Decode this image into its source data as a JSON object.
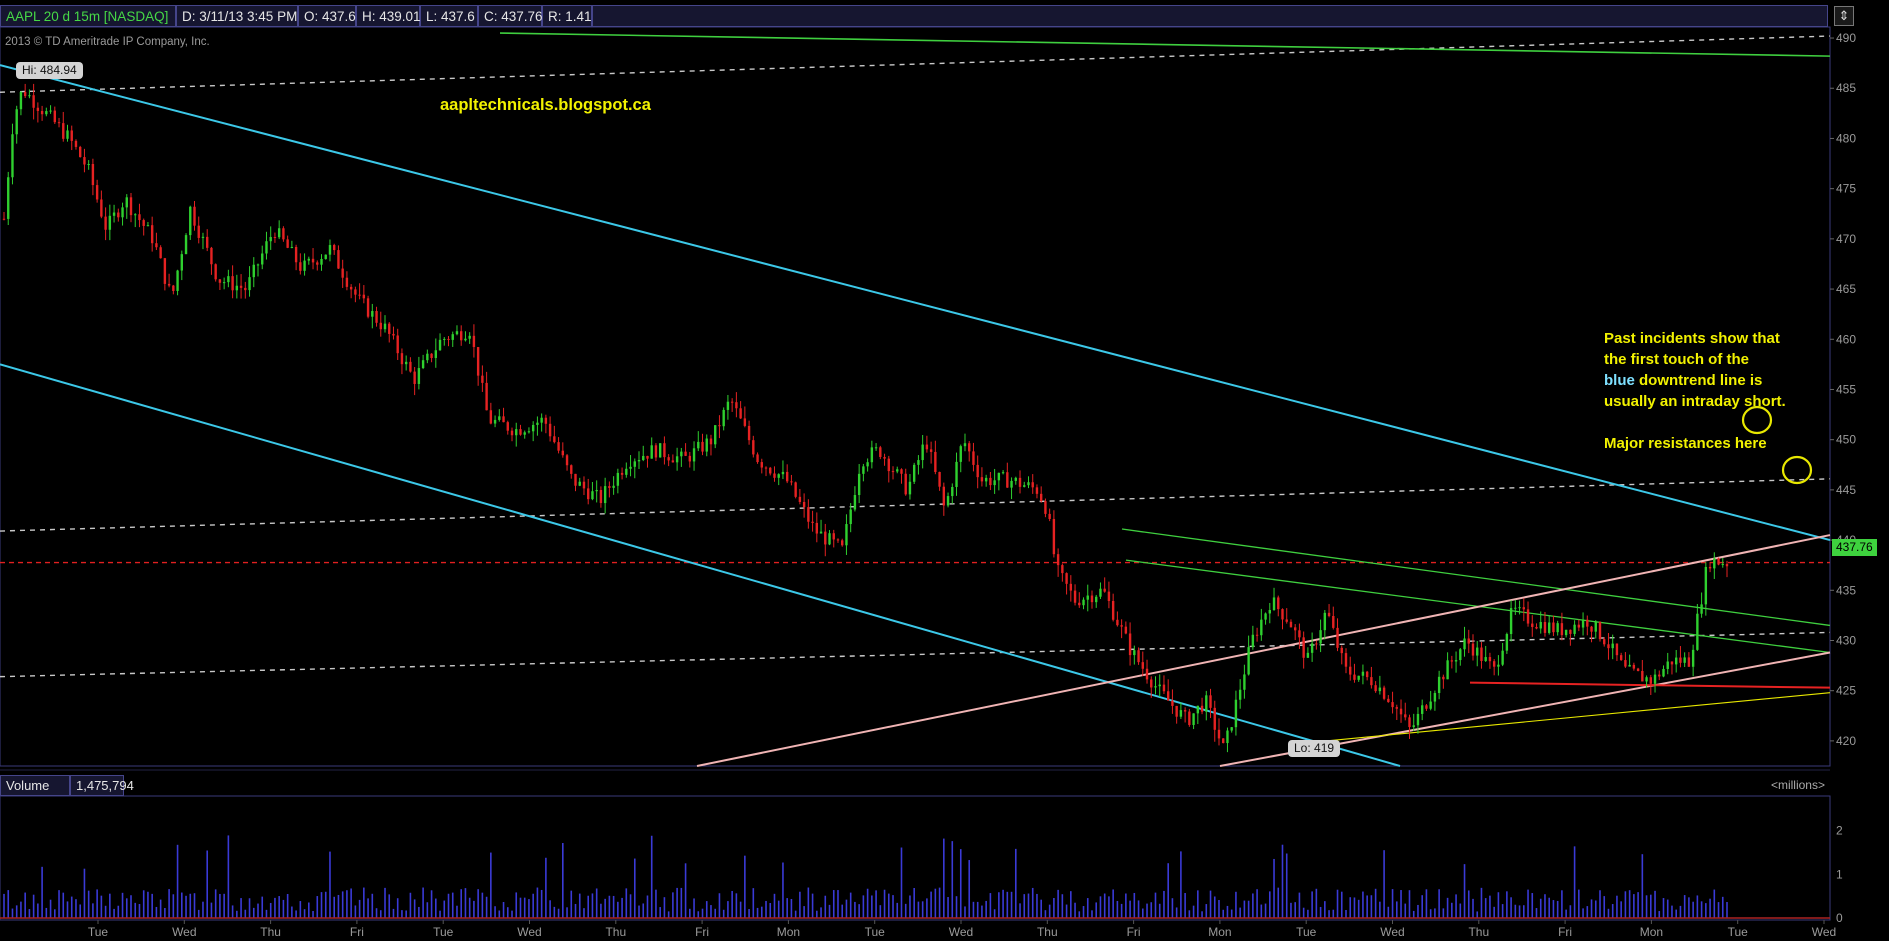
{
  "header": {
    "symbol": "AAPL 20 d 15m [NASDAQ]",
    "date": "D: 3/11/13 3:45 PM",
    "open": "O: 437.6",
    "high": "H: 439.01",
    "low": "L: 437.6",
    "close": "C: 437.76",
    "range": "R: 1.41"
  },
  "copyright": "2013 © TD Ameritrade IP Company, Inc.",
  "watermark": "aapltechnicals.blogspot.ca",
  "annotation": {
    "line1": "Past incidents show that",
    "line2": "the first touch of the",
    "line3_blue": "blue",
    "line3_rest": " downtrend line is",
    "line4": "usually an intraday short.",
    "line5": "Major resistances here"
  },
  "hi_label": "Hi: 484.94",
  "lo_label": "Lo: 419",
  "last_price_label": "437.76",
  "volume_header": {
    "label": "Volume",
    "value": "1,475,794"
  },
  "volume_units": "<millions>",
  "colors": {
    "up": "#2fd02f",
    "down": "#e62222",
    "cyan": "#3cc8e8",
    "pink": "#f0b4b4",
    "green_line": "#3fcf3f",
    "yellow": "#e8e800",
    "volume": "#3a3ad6",
    "grid_dash": "#c8c8c8",
    "last_price_dash": "#e02020"
  },
  "chart_data": [
    {
      "type": "candlestick",
      "interval": "15m",
      "ylim": [
        417.5,
        491
      ],
      "price_ticks": [
        420,
        425,
        430,
        435,
        440,
        445,
        450,
        455,
        460,
        465,
        470,
        475,
        480,
        485,
        490
      ],
      "x_ticks": [
        "Tue",
        "Wed",
        "Thu",
        "Fri",
        "Tue",
        "Wed",
        "Thu",
        "Fri",
        "Mon",
        "Tue",
        "Wed",
        "Thu",
        "Fri",
        "Mon",
        "Tue",
        "Wed",
        "Thu",
        "Fri",
        "Mon",
        "Tue",
        "Wed"
      ],
      "close_path": [
        {
          "t": 0,
          "p": 472
        },
        {
          "t": 1,
          "p": 482
        },
        {
          "t": 2,
          "p": 484.9
        },
        {
          "t": 4,
          "p": 483
        },
        {
          "t": 7,
          "p": 480
        },
        {
          "t": 9,
          "p": 477
        },
        {
          "t": 11,
          "p": 471
        },
        {
          "t": 13,
          "p": 474
        },
        {
          "t": 16,
          "p": 470
        },
        {
          "t": 18,
          "p": 464
        },
        {
          "t": 20,
          "p": 473
        },
        {
          "t": 23,
          "p": 466
        },
        {
          "t": 26,
          "p": 465
        },
        {
          "t": 29,
          "p": 471
        },
        {
          "t": 32,
          "p": 467
        },
        {
          "t": 35,
          "p": 469
        },
        {
          "t": 38,
          "p": 464
        },
        {
          "t": 41,
          "p": 461
        },
        {
          "t": 44,
          "p": 456
        },
        {
          "t": 47,
          "p": 460
        },
        {
          "t": 50,
          "p": 461
        },
        {
          "t": 52,
          "p": 452
        },
        {
          "t": 55,
          "p": 451
        },
        {
          "t": 58,
          "p": 452
        },
        {
          "t": 61,
          "p": 446
        },
        {
          "t": 64,
          "p": 444
        },
        {
          "t": 67,
          "p": 448
        },
        {
          "t": 70,
          "p": 449
        },
        {
          "t": 73,
          "p": 448
        },
        {
          "t": 76,
          "p": 450
        },
        {
          "t": 78,
          "p": 454
        },
        {
          "t": 81,
          "p": 448
        },
        {
          "t": 84,
          "p": 446
        },
        {
          "t": 87,
          "p": 441
        },
        {
          "t": 90,
          "p": 439
        },
        {
          "t": 92,
          "p": 448
        },
        {
          "t": 94,
          "p": 449
        },
        {
          "t": 97,
          "p": 445
        },
        {
          "t": 99,
          "p": 450
        },
        {
          "t": 101,
          "p": 443
        },
        {
          "t": 103,
          "p": 450
        },
        {
          "t": 105,
          "p": 446
        },
        {
          "t": 108,
          "p": 446
        },
        {
          "t": 111,
          "p": 445
        },
        {
          "t": 112,
          "p": 443
        },
        {
          "t": 113,
          "p": 437
        },
        {
          "t": 115,
          "p": 434
        },
        {
          "t": 118,
          "p": 435
        },
        {
          "t": 121,
          "p": 429
        },
        {
          "t": 124,
          "p": 425
        },
        {
          "t": 127,
          "p": 422
        },
        {
          "t": 129,
          "p": 424
        },
        {
          "t": 131,
          "p": 419
        },
        {
          "t": 134,
          "p": 430
        },
        {
          "t": 136,
          "p": 434
        },
        {
          "t": 138,
          "p": 432
        },
        {
          "t": 140,
          "p": 428
        },
        {
          "t": 142,
          "p": 433
        },
        {
          "t": 144,
          "p": 427
        },
        {
          "t": 147,
          "p": 426
        },
        {
          "t": 149,
          "p": 424
        },
        {
          "t": 151,
          "p": 421
        },
        {
          "t": 154,
          "p": 426
        },
        {
          "t": 157,
          "p": 430
        },
        {
          "t": 160,
          "p": 427
        },
        {
          "t": 162,
          "p": 433
        },
        {
          "t": 164,
          "p": 432
        },
        {
          "t": 167,
          "p": 431
        },
        {
          "t": 170,
          "p": 432
        },
        {
          "t": 172,
          "p": 430
        },
        {
          "t": 174,
          "p": 427
        },
        {
          "t": 177,
          "p": 426
        },
        {
          "t": 179,
          "p": 428
        },
        {
          "t": 181,
          "p": 428
        },
        {
          "t": 183,
          "p": 438
        },
        {
          "t": 185,
          "p": 437.76
        }
      ],
      "hi": 484.94,
      "lo": 419,
      "last": 437.76
    },
    {
      "type": "bar",
      "series": "volume",
      "ylim": [
        0,
        2.7
      ],
      "volume_ticks": [
        0,
        1,
        2
      ]
    }
  ]
}
